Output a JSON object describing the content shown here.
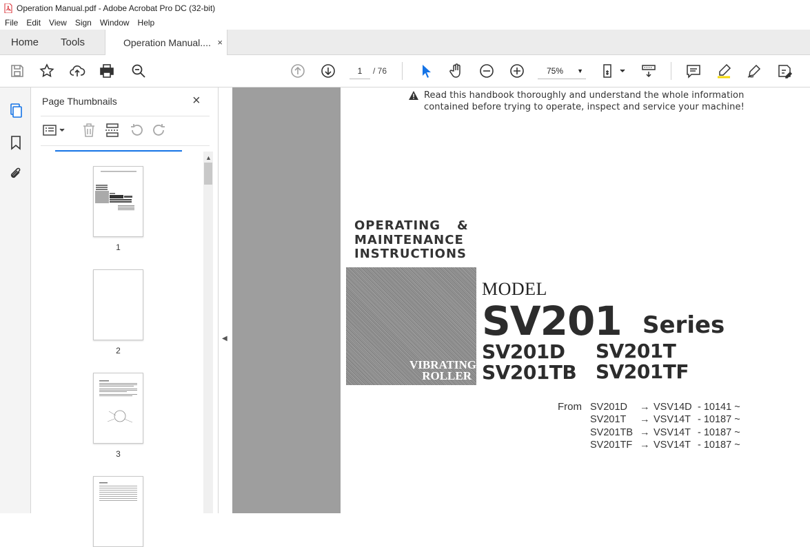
{
  "window": {
    "title": "Operation Manual.pdf - Adobe Acrobat Pro DC (32-bit)"
  },
  "menu": [
    "File",
    "Edit",
    "View",
    "Sign",
    "Window",
    "Help"
  ],
  "tabs": {
    "home": "Home",
    "tools": "Tools",
    "document": "Operation Manual....",
    "close": "×"
  },
  "toolbar": {
    "current_page": "1",
    "page_total": "/ 76",
    "zoom": "75%"
  },
  "sidebar": {
    "title": "Page Thumbnails",
    "close": "×",
    "thumbnails": [
      {
        "label": "1"
      },
      {
        "label": "2"
      },
      {
        "label": "3"
      }
    ]
  },
  "colors": {
    "accent": "#1473e6",
    "pdf_red": "#d7282f",
    "doc_bg": "#9e9e9e"
  },
  "document": {
    "notice_line1": "Read this handbook thoroughly and understand the whole information",
    "notice_line2": "contained before trying to operate, inspect and service your machine!",
    "heading_line1": "OPERATING",
    "heading_amp": "&",
    "heading_line2": "MAINTENANCE",
    "heading_line3": "INSTRUCTIONS",
    "photo_label_1": "VIBRATING",
    "photo_label_2": "ROLLER",
    "model_word": "MODEL",
    "model_name": "SV201",
    "model_series": "Series",
    "variants": [
      "SV201D",
      "SV201T",
      "SV201TB",
      "SV201TF"
    ],
    "from_label": "From",
    "serials": [
      {
        "model": "SV201D",
        "arrow": "→",
        "vin": "VSV14D",
        "num": "- 10141 ~"
      },
      {
        "model": "SV201T",
        "arrow": "→",
        "vin": "VSV14T",
        "num": "- 10187 ~"
      },
      {
        "model": "SV201TB",
        "arrow": "→",
        "vin": "VSV14T",
        "num": "- 10187 ~"
      },
      {
        "model": "SV201TF",
        "arrow": "→",
        "vin": "VSV14T",
        "num": "- 10187 ~"
      }
    ]
  }
}
